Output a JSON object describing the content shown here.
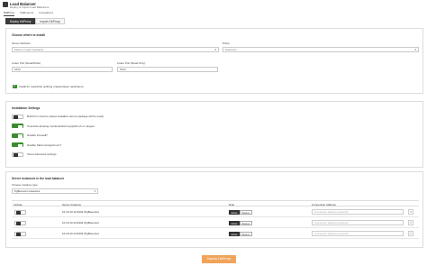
{
  "header": {
    "title": "Load Balancer",
    "subtitle": "Deploy & Import Load Balancers",
    "tabs": [
      "HAProxy",
      "PgBouncer",
      "Keepalived"
    ],
    "active_tab": "HAProxy"
  },
  "mode_tabs": [
    "Deploy HAProxy",
    "Import HAProxy"
  ],
  "where": {
    "title": "Choose where to install",
    "server_address_label": "Server Address",
    "server_address_placeholder": "Select or type hostname",
    "policy_label": "Policy",
    "policy_value": "leastconn",
    "rw_port_label": "Listen Port (Read/Write)",
    "rw_port_value": "5433",
    "ro_port_label": "Listen Port (Read Only)",
    "ro_port_value": "5434",
    "rw_split_label": "Install for read/write splitting (master/slave replication)"
  },
  "installation": {
    "title": "Installation Settings",
    "options": [
      {
        "label": "Build from Source (latest available source package will be used)",
        "on": false
      },
      {
        "label": "Overwrite Existing /usr/local/sbin/mysqlchk.sh on targets",
        "on": true
      },
      {
        "label": "Disable Firewall?",
        "on": true
      },
      {
        "label": "Disable SELinux/AppArmor?",
        "on": true
      },
      {
        "label": "Show advanced settings",
        "on": false
      }
    ]
  },
  "instances": {
    "title": "Server instances in the load balancer",
    "choose_label": "Choose instance type",
    "instance_type": "PgBouncer instances",
    "columns": [
      "Include",
      "Server Instance",
      "Role",
      "Connection Address"
    ],
    "seg_labels": [
      "Active",
      "Backup"
    ],
    "address_placeholder": "Connection address (optional)",
    "rows": [
      {
        "server": "10.10.10.12:6432 (PgBouncer)"
      },
      {
        "server": "10.10.10.13:6432 (PgBouncer)"
      },
      {
        "server": "10.10.10.14:6432 (PgBouncer)"
      }
    ]
  },
  "deploy_button": "Deploy HAProxy",
  "icons": {
    "chevron": "chevron-down-icon",
    "close": "close-icon"
  }
}
